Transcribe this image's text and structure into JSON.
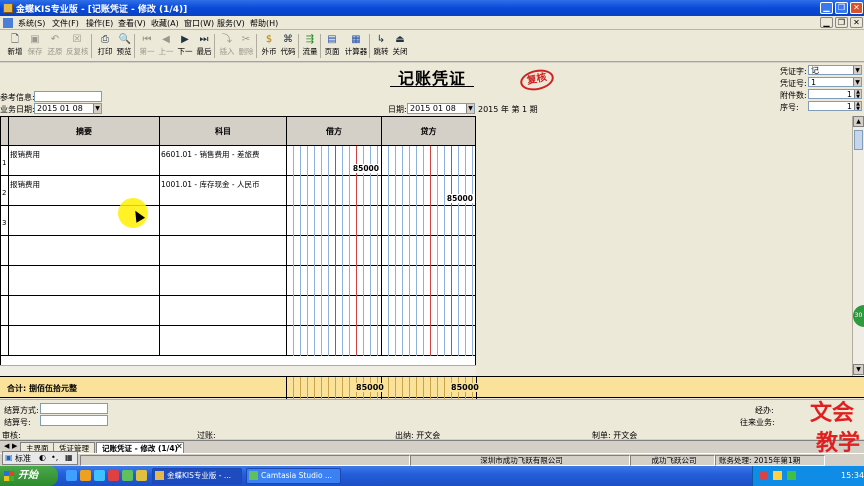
{
  "window": {
    "title": "金蝶KIS专业版 - [记账凭证 - 修改 (1/4)]"
  },
  "menu": [
    {
      "label": "系统(S)"
    },
    {
      "label": "文件(F)"
    },
    {
      "label": "操作(E)"
    },
    {
      "label": "查看(V)"
    },
    {
      "label": "收藏(A)"
    },
    {
      "label": "窗口(W)"
    },
    {
      "label": "服务(V)"
    },
    {
      "label": "帮助(H)"
    }
  ],
  "toolbar": [
    {
      "label": "新增",
      "icon": "new-doc-icon",
      "disabled": false
    },
    {
      "label": "保存",
      "icon": "save-icon",
      "disabled": true
    },
    {
      "label": "还原",
      "icon": "restore-icon",
      "disabled": true
    },
    {
      "label": "反复核",
      "icon": "unreview-icon",
      "disabled": true
    },
    {
      "label": "打印",
      "icon": "print-icon",
      "disabled": false
    },
    {
      "label": "预览",
      "icon": "preview-icon",
      "disabled": false
    },
    {
      "label": "第一",
      "icon": "first-icon",
      "disabled": true
    },
    {
      "label": "上一",
      "icon": "prev-icon",
      "disabled": true
    },
    {
      "label": "下一",
      "icon": "next-icon",
      "disabled": false
    },
    {
      "label": "最后",
      "icon": "last-icon",
      "disabled": false
    },
    {
      "label": "插入",
      "icon": "insert-icon",
      "disabled": true
    },
    {
      "label": "删除",
      "icon": "delete-icon",
      "disabled": true
    },
    {
      "label": "外币",
      "icon": "currency-icon",
      "disabled": false
    },
    {
      "label": "代码",
      "icon": "code-icon",
      "disabled": false
    },
    {
      "label": "流量",
      "icon": "flow-icon",
      "disabled": false
    },
    {
      "label": "页面",
      "icon": "page-icon",
      "disabled": false
    },
    {
      "label": "计算器",
      "icon": "calculator-icon",
      "disabled": false
    },
    {
      "label": "跳转",
      "icon": "jump-icon",
      "disabled": false
    },
    {
      "label": "关闭",
      "icon": "close-icon",
      "disabled": false
    }
  ],
  "voucher": {
    "title": "记账凭证",
    "stamp": "复核",
    "ref_label": "参考信息:",
    "ref_value": "",
    "biz_date_label": "业务日期:",
    "biz_date_value": "2015 01 08",
    "date_label": "日期:",
    "date_value": "2015 01 08",
    "period_text": "2015 年 第 1 期",
    "word_label": "凭证字:",
    "word_value": "记",
    "number_label": "凭证号:",
    "number_value": "1",
    "attach_label": "附件数:",
    "attach_value": "1",
    "seq_label": "序号:",
    "seq_value": "1"
  },
  "grid": {
    "headers": {
      "summary": "摘要",
      "account": "科目",
      "debit": "借方",
      "credit": "贷方"
    },
    "rows": [
      {
        "num": "1",
        "summary": "报销费用",
        "account": "6601.01 - 销售费用 - 差旅费",
        "debit": "85000",
        "credit": ""
      },
      {
        "num": "2",
        "summary": "报销费用",
        "account": "1001.01 - 库存现金 - 人民币",
        "debit": "",
        "credit": "85000"
      },
      {
        "num": "3",
        "summary": "",
        "account": "",
        "debit": "",
        "credit": ""
      },
      {
        "num": "",
        "summary": "",
        "account": "",
        "debit": "",
        "credit": ""
      },
      {
        "num": "",
        "summary": "",
        "account": "",
        "debit": "",
        "credit": ""
      },
      {
        "num": "",
        "summary": "",
        "account": "",
        "debit": "",
        "credit": ""
      },
      {
        "num": "",
        "summary": "",
        "account": "",
        "debit": "",
        "credit": ""
      }
    ],
    "total_label": "合计: 捌佰伍拾元整",
    "total_debit": "85000",
    "total_credit": "85000"
  },
  "footer": {
    "settle_label": "结算方式:",
    "settle_no_label": "结算号:",
    "handler_label": "经办:",
    "contact_label": "往来业务:",
    "audit_label": "审核:",
    "post_label": "过账:",
    "cashier_label": "出纳: 开文会",
    "maker_label": "制单: 开文会"
  },
  "tabs": [
    {
      "label": "主界面",
      "active": false
    },
    {
      "label": "凭证管理",
      "active": false
    },
    {
      "label": "记账凭证 - 修改 (1/4)",
      "active": true
    }
  ],
  "statusbar": {
    "company": "深圳市成功飞跃有限公司",
    "company2": "成功飞跃公司",
    "account_info": "账务处理: 2015年第1期"
  },
  "ime": {
    "label": "标准"
  },
  "taskbar": {
    "start": "开始",
    "tasks": [
      {
        "label": "金蝶KIS专业版 - ...",
        "active": true
      },
      {
        "label": "Camtasia Studio ...",
        "active": false
      }
    ],
    "clock": "15:34"
  },
  "watermark": {
    "line1": "文会",
    "line2": "教学"
  },
  "side_badge": "30"
}
